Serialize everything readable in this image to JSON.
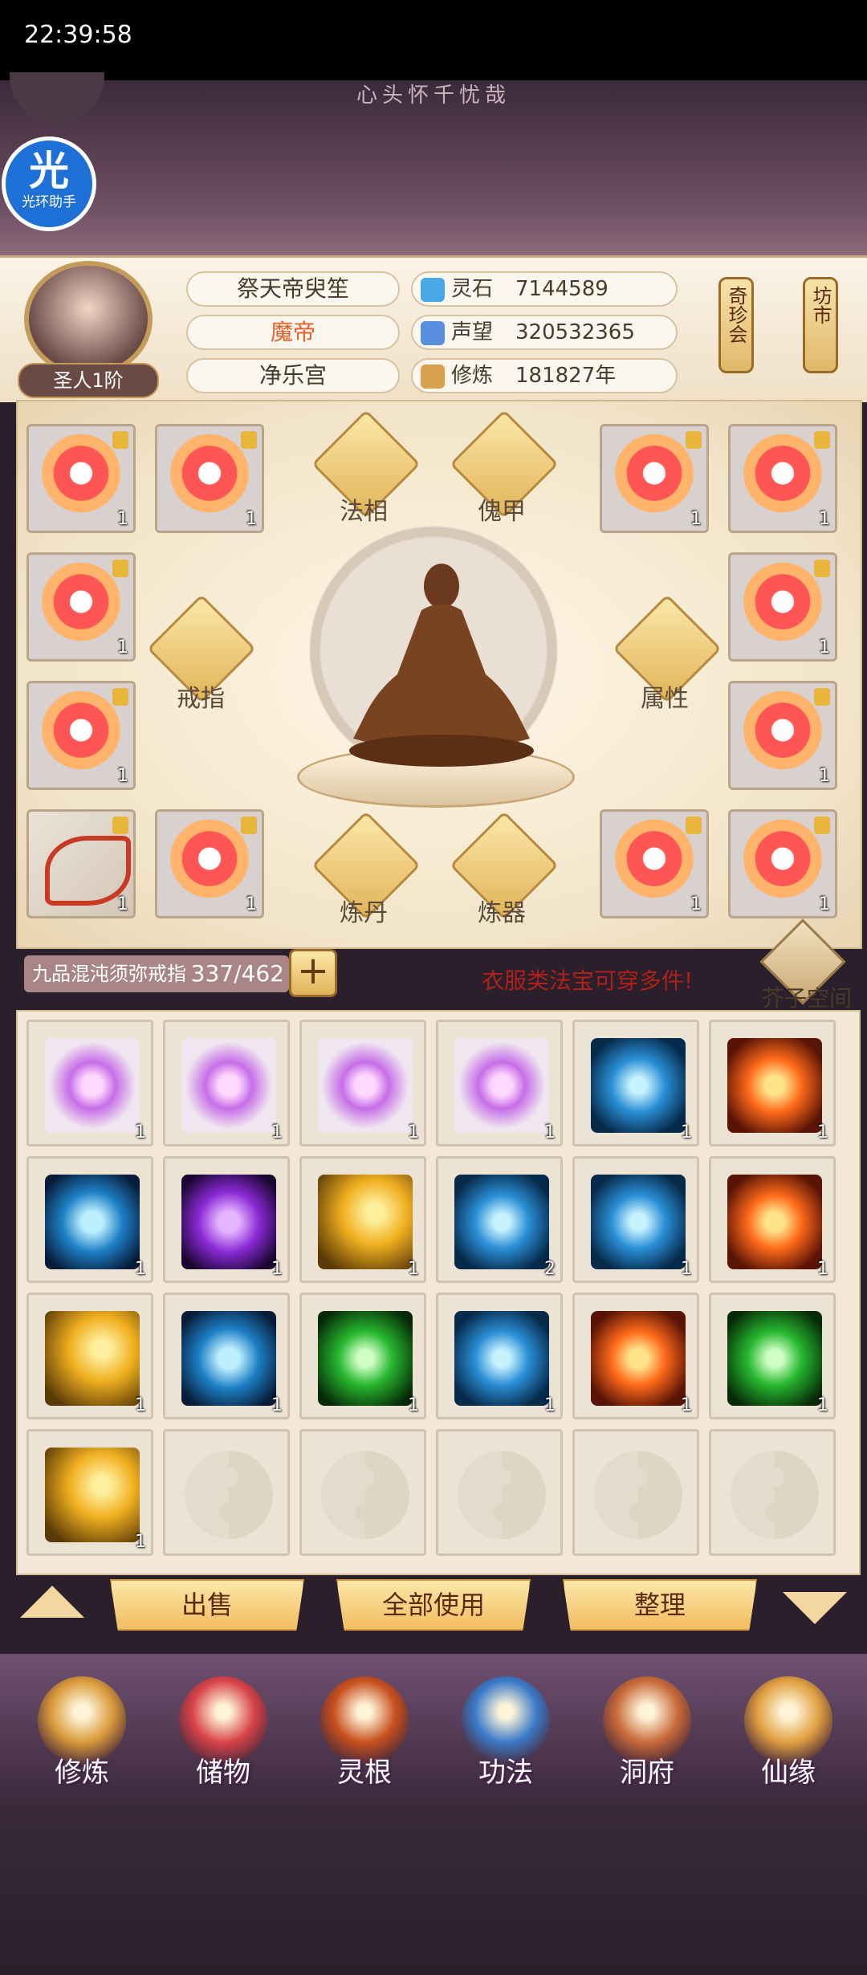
{
  "status": {
    "time": "22:39:58"
  },
  "poem": "心头怀千忧哉",
  "helper": {
    "big": "光",
    "small": "光环助手"
  },
  "player": {
    "name": "祭天帝臾笙",
    "title": "魔帝",
    "faction": "净乐宫",
    "realm": "圣人1阶"
  },
  "stats": [
    {
      "label": "灵石",
      "value": "7144589",
      "icon": "spirit-stone-icon",
      "color": "#4aa8e8"
    },
    {
      "label": "声望",
      "value": "320532365",
      "icon": "reputation-icon",
      "color": "#5a8fe0"
    },
    {
      "label": "修炼",
      "value": "181827年",
      "icon": "cultivation-icon",
      "color": "#d9a050"
    }
  ],
  "shops": [
    {
      "label": "奇珍会"
    },
    {
      "label": "坊市"
    }
  ],
  "equip_slots": {
    "fa_xiang": "法相",
    "kui_jia": "傀甲",
    "jie_zhi": "戒指",
    "shu_xing": "属性",
    "lian_dan": "炼丹",
    "lian_qi": "炼器"
  },
  "equipped": [
    {
      "type": "robe",
      "count": "1"
    },
    {
      "type": "robe",
      "count": "1"
    },
    {
      "type": "robe",
      "count": "1"
    },
    {
      "type": "robe",
      "count": "1"
    },
    {
      "type": "robe",
      "count": "1"
    },
    {
      "type": "robe",
      "count": "1"
    },
    {
      "type": "robe",
      "count": "1"
    },
    {
      "type": "robe",
      "count": "1"
    },
    {
      "type": "bow",
      "count": "1"
    },
    {
      "type": "robe",
      "count": "1"
    },
    {
      "type": "robe",
      "count": "1"
    },
    {
      "type": "robe",
      "count": "1"
    }
  ],
  "capacity": {
    "name": "九品混沌须弥戒指",
    "used": 337,
    "total": 462,
    "text": "337/462"
  },
  "hint": "衣服类法宝可穿多件!",
  "space_label": "芥子空间",
  "bag": [
    {
      "kind": "crystal",
      "count": "1"
    },
    {
      "kind": "crystal",
      "count": "1"
    },
    {
      "kind": "crystal",
      "count": "1"
    },
    {
      "kind": "crystal",
      "count": "1"
    },
    {
      "kind": "blue",
      "count": "1"
    },
    {
      "kind": "fire",
      "count": "1"
    },
    {
      "kind": "ghost",
      "count": "1"
    },
    {
      "kind": "purple",
      "count": "1"
    },
    {
      "kind": "gold",
      "count": "1"
    },
    {
      "kind": "blue",
      "count": "2"
    },
    {
      "kind": "blue",
      "count": "1"
    },
    {
      "kind": "fire",
      "count": "1"
    },
    {
      "kind": "gold",
      "count": "1"
    },
    {
      "kind": "ghost",
      "count": "1"
    },
    {
      "kind": "green",
      "count": "1"
    },
    {
      "kind": "blue",
      "count": "1"
    },
    {
      "kind": "fire",
      "count": "1"
    },
    {
      "kind": "green",
      "count": "1"
    },
    {
      "kind": "gold",
      "count": "1"
    },
    {
      "kind": "empty",
      "count": ""
    },
    {
      "kind": "empty",
      "count": ""
    },
    {
      "kind": "empty",
      "count": ""
    },
    {
      "kind": "empty",
      "count": ""
    },
    {
      "kind": "empty",
      "count": ""
    }
  ],
  "actions": {
    "sell": "出售",
    "use_all": "全部使用",
    "sort": "整理"
  },
  "nav": [
    {
      "label": "修炼",
      "icon": "monk-icon",
      "color": "#d99a3a"
    },
    {
      "label": "储物",
      "icon": "bag-icon",
      "color": "#d9434a"
    },
    {
      "label": "灵根",
      "icon": "spirit-root-icon",
      "color": "#c8501e"
    },
    {
      "label": "功法",
      "icon": "scroll-book-icon",
      "color": "#3a7ac8"
    },
    {
      "label": "洞府",
      "icon": "cave-house-icon",
      "color": "#c86a3a"
    },
    {
      "label": "仙缘",
      "icon": "gourd-icon",
      "color": "#e0a040"
    }
  ]
}
